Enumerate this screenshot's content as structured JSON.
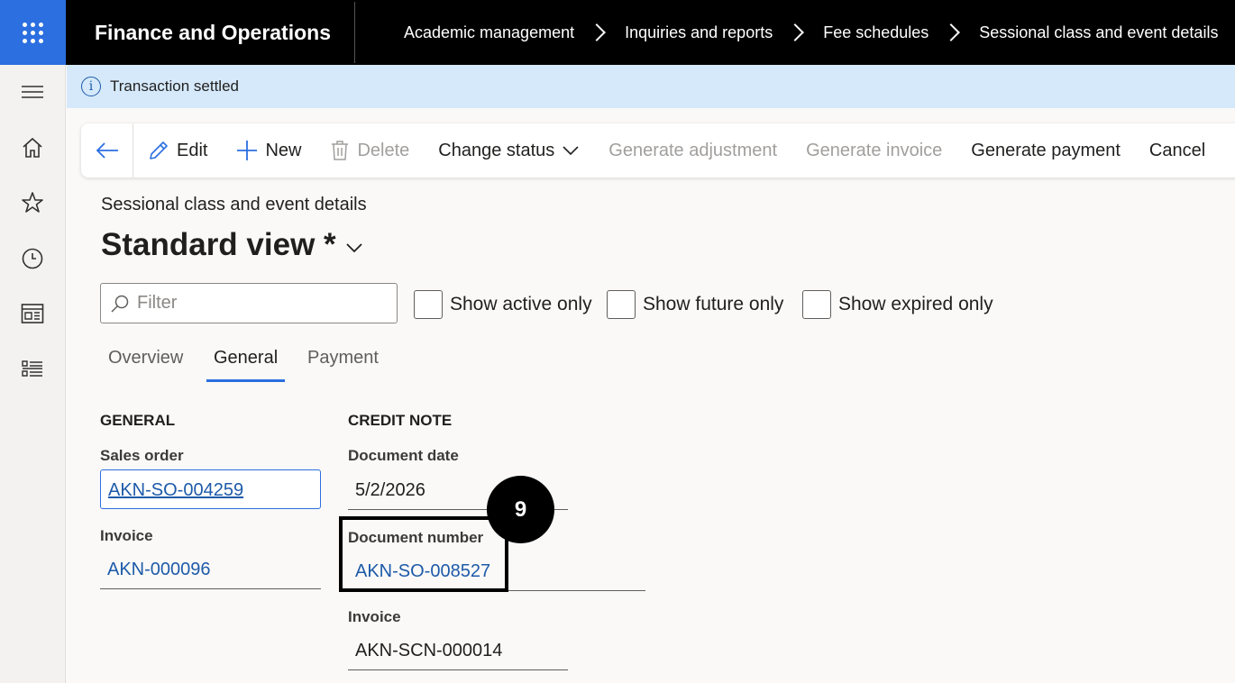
{
  "app": {
    "title": "Finance and Operations"
  },
  "breadcrumb": [
    "Academic management",
    "Inquiries and reports",
    "Fee schedules",
    "Sessional class and event details"
  ],
  "rail": {
    "items": [
      "menu-icon",
      "home-icon",
      "star-icon",
      "clock-icon",
      "workspace-icon",
      "list-icon"
    ]
  },
  "info_bar": {
    "message": "Transaction settled"
  },
  "action_pane": {
    "edit": "Edit",
    "new": "New",
    "delete": "Delete",
    "change_status": "Change status",
    "generate_adjustment": "Generate adjustment",
    "generate_invoice": "Generate invoice",
    "generate_payment": "Generate payment",
    "cancel": "Cancel"
  },
  "page": {
    "caption": "Sessional class and event details",
    "view_name": "Standard view *"
  },
  "filter": {
    "placeholder": "Filter",
    "value": ""
  },
  "checkboxes": {
    "active": "Show active only",
    "future": "Show future only",
    "expired": "Show expired only"
  },
  "tabs": {
    "overview": "Overview",
    "general": "General",
    "payment": "Payment"
  },
  "general": {
    "heading": "GENERAL",
    "sales_order_label": "Sales order",
    "sales_order_value": "AKN-SO-004259",
    "invoice_label": "Invoice",
    "invoice_value": "AKN-000096"
  },
  "credit_note": {
    "heading": "CREDIT NOTE",
    "document_date_label": "Document date",
    "document_date_value": "5/2/2026",
    "document_number_label": "Document number",
    "document_number_value": "AKN-SO-008527",
    "invoice_label": "Invoice",
    "invoice_value": "AKN-SCN-000014"
  },
  "annotation": {
    "step": "9"
  },
  "colors": {
    "accent": "#2b6fe0",
    "info_bg": "#d5e9fb",
    "link": "#1d5aa8"
  }
}
